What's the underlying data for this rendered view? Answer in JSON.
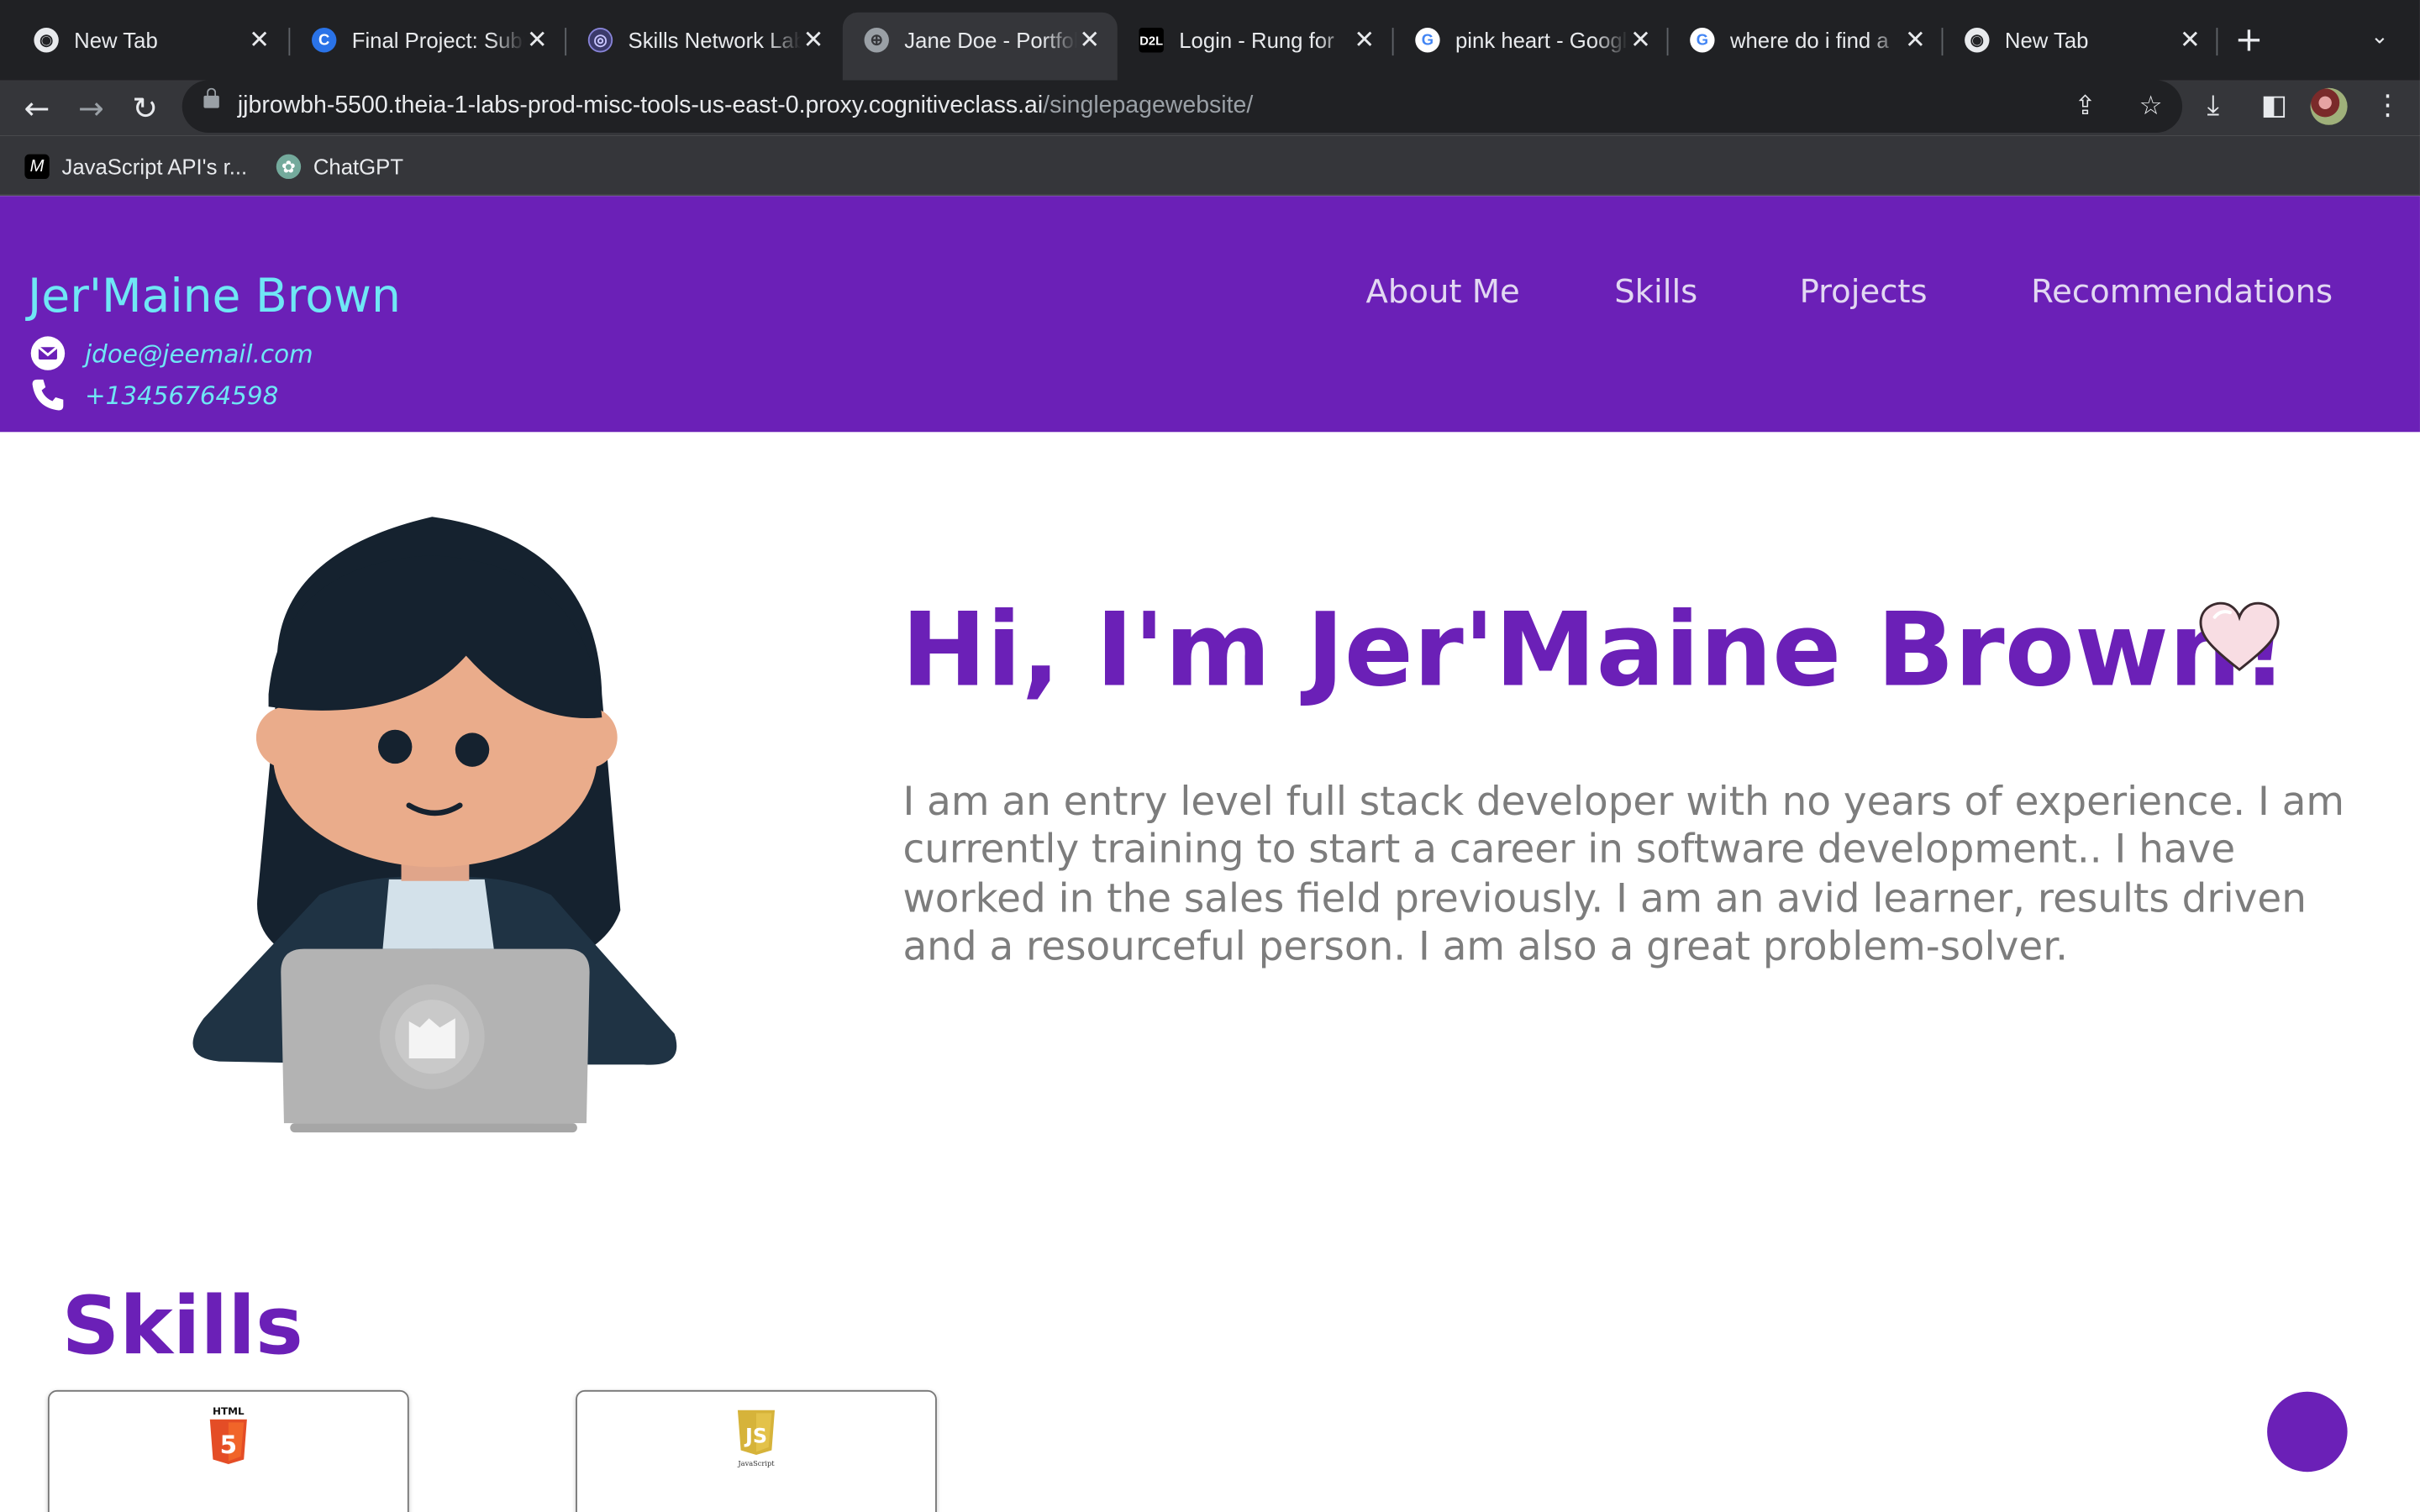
{
  "browser": {
    "tabs": [
      {
        "title": "New Tab",
        "icon": "chrome-icon",
        "active": false
      },
      {
        "title": "Final Project: Submit",
        "icon": "coursera-icon",
        "active": false
      },
      {
        "title": "Skills Network Labs",
        "icon": "skills-network-icon",
        "active": false
      },
      {
        "title": "Jane Doe - Portfolio",
        "icon": "globe-icon",
        "active": true
      },
      {
        "title": "Login - Rung for",
        "icon": "d2l-icon",
        "active": false
      },
      {
        "title": "pink heart - Google",
        "icon": "google-icon",
        "active": false
      },
      {
        "title": "where do i find a",
        "icon": "google-icon",
        "active": false
      },
      {
        "title": "New Tab",
        "icon": "chrome-icon",
        "active": false
      }
    ],
    "url_host": "jjbrowbh-5500.theia-1-labs-prod-misc-tools-us-east-0.proxy.cognitiveclass.ai",
    "url_path": "/singlepagewebsite/",
    "bookmarks": [
      {
        "label": "JavaScript API's r...",
        "icon": "medium-icon"
      },
      {
        "label": "ChatGPT",
        "icon": "chatgpt-icon"
      }
    ]
  },
  "header": {
    "name": "Jer'Maine Brown",
    "email": "jdoe@jeemail.com",
    "phone": "+13456764598",
    "nav": [
      "About Me",
      "Skills",
      "Projects",
      "Recommendations"
    ]
  },
  "hero": {
    "greeting": "Hi, I'm Jer'Maine Brown!",
    "bio": "I am an entry level full stack developer with no years of experience. I am currently training to start a career in software development.. I have worked in the sales field previously. I am an avid learner, results driven and a resourceful person. I am also a great problem-solver."
  },
  "skills": {
    "heading": "Skills",
    "cards": [
      {
        "name": "HTML",
        "icon": "html5-icon"
      },
      {
        "name": "JavaScript",
        "icon": "javascript-icon"
      }
    ]
  },
  "colors": {
    "brand_purple": "#6b20b7",
    "accent_cyan": "#6fe7f5",
    "bio_gray": "#7d7d7d"
  }
}
